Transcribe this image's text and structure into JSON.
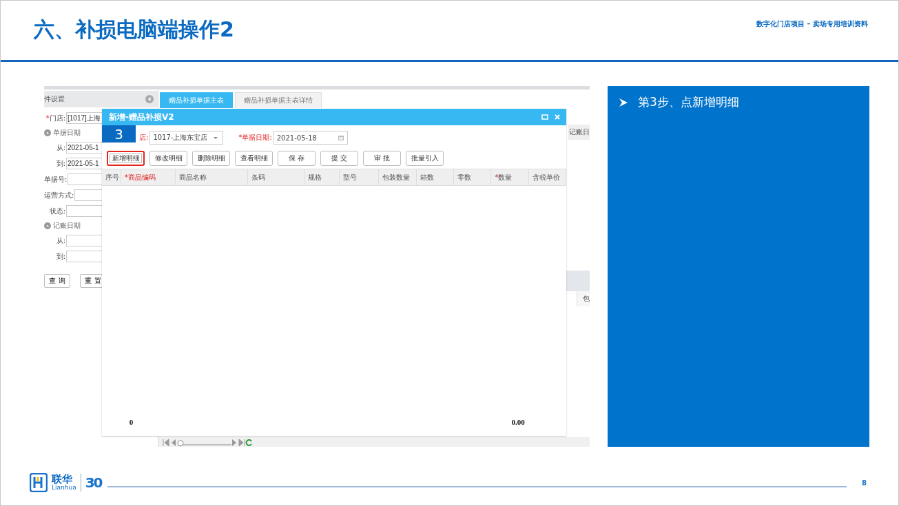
{
  "slide": {
    "title": "六、补损电脑端操作2",
    "subtitle": "数字化门店项目 – 卖场专用培训资料",
    "page_number": "8"
  },
  "app": {
    "left_panel": {
      "header": "件设置",
      "rows": [
        {
          "kind": "field",
          "mark": "*",
          "label": "门店:",
          "value": "[1017]上海"
        },
        {
          "kind": "section",
          "label": "单据日期"
        },
        {
          "kind": "field",
          "label": "从:",
          "value": "2021-05-1"
        },
        {
          "kind": "field",
          "label": "到:",
          "value": "2021-05-1"
        },
        {
          "kind": "field",
          "label": "单据号:"
        },
        {
          "kind": "field",
          "label": "运营方式:"
        },
        {
          "kind": "field",
          "label": "状态:"
        },
        {
          "kind": "section",
          "label": "记账日期"
        },
        {
          "kind": "field",
          "label": "从:"
        },
        {
          "kind": "field",
          "label": "到:"
        }
      ],
      "buttons": [
        "查 询",
        "重 置"
      ]
    },
    "tabs": [
      {
        "label": "赠品补损单据主表",
        "selected": true
      },
      {
        "label": "赠品补损单据主表详情",
        "selected": false
      }
    ],
    "background_fragments": {
      "field_label": "记账日",
      "column_header": "包"
    },
    "dialog": {
      "title": "新增-赠品补损V2",
      "step_badge": "3",
      "fields": [
        {
          "label": "店:",
          "kind": "select",
          "value": "1017-上海东宝店",
          "required": true
        },
        {
          "label": "*单据日期:",
          "kind": "date",
          "value": "2021-05-18",
          "required": true
        }
      ],
      "buttons": [
        {
          "label": "新增明细",
          "highlighted": true
        },
        {
          "label": "修改明细",
          "highlighted": false
        },
        {
          "label": "删除明细",
          "highlighted": false
        },
        {
          "label": "查看明细",
          "highlighted": false
        },
        {
          "label": "保 存",
          "highlighted": false
        },
        {
          "label": "提 交",
          "highlighted": false
        },
        {
          "label": "审 批",
          "highlighted": false
        },
        {
          "label": "批量引入",
          "highlighted": false
        }
      ],
      "columns": [
        {
          "label": "序号",
          "required": false
        },
        {
          "label": "商品编码",
          "mark": "*",
          "required": true,
          "total": "0"
        },
        {
          "label": "商品名称",
          "required": false
        },
        {
          "label": "条码",
          "required": false
        },
        {
          "label": "规格",
          "required": false
        },
        {
          "label": "型号",
          "required": false
        },
        {
          "label": "包装数量",
          "required": false
        },
        {
          "label": "箱数",
          "required": false
        },
        {
          "label": "零数",
          "required": false
        },
        {
          "label": "数量",
          "mark": "*",
          "required": false,
          "total": "0.00"
        },
        {
          "label": "含税单价",
          "required": false
        }
      ]
    }
  },
  "instruction_panel": {
    "bullets": [
      "第3步、点新增明细"
    ]
  },
  "footer": {
    "brand": "联华",
    "brand_latin": "Lianhua",
    "anniversary": "30"
  }
}
